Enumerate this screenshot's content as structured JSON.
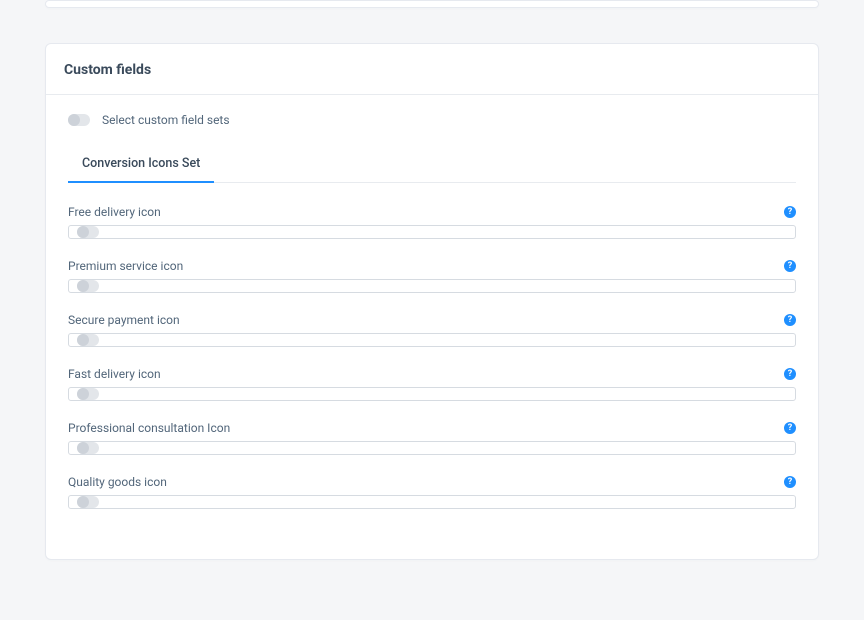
{
  "card": {
    "title": "Custom fields",
    "selectLabel": "Select custom field sets"
  },
  "tabs": [
    {
      "label": "Conversion Icons Set",
      "active": true
    }
  ],
  "fields": [
    {
      "label": "Free delivery icon"
    },
    {
      "label": "Premium service icon"
    },
    {
      "label": "Secure payment icon"
    },
    {
      "label": "Fast delivery icon"
    },
    {
      "label": "Professional consultation Icon"
    },
    {
      "label": "Quality goods icon"
    }
  ],
  "help": {
    "glyph": "?"
  }
}
